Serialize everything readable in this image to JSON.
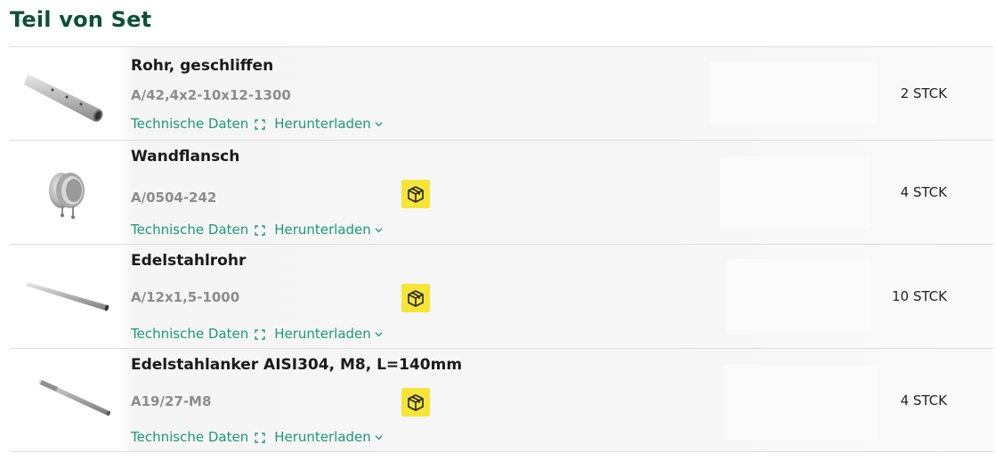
{
  "section": {
    "title": "Teil von Set"
  },
  "colors": {
    "title": "#0d4f3a",
    "link": "#1a9a7a",
    "badge": "#f6e534"
  },
  "parts": [
    {
      "name": "Rohr, geschliffen",
      "code": "A/42,4x2-10x12-1300",
      "tech_label": "Technische Daten",
      "download_label": "Herunterladen",
      "quantity": "2 STCK",
      "has_box_badge": false,
      "image_icon": "pipe-with-holes-icon"
    },
    {
      "name": "Wandflansch",
      "code": "A/0504-242",
      "tech_label": "Technische Daten",
      "download_label": "Herunterladen",
      "quantity": "4 STCK",
      "has_box_badge": true,
      "image_icon": "wall-flange-icon"
    },
    {
      "name": "Edelstahlrohr",
      "code": "A/12x1,5-1000",
      "tech_label": "Technische Daten",
      "download_label": "Herunterladen",
      "quantity": "10 STCK",
      "has_box_badge": true,
      "image_icon": "thin-pipe-icon"
    },
    {
      "name": "Edelstahlanker AISI304, M8, L=140mm",
      "code": "A19/27-M8",
      "tech_label": "Technische Daten",
      "download_label": "Herunterladen",
      "quantity": "4 STCK",
      "has_box_badge": true,
      "image_icon": "anchor-rod-icon"
    }
  ]
}
